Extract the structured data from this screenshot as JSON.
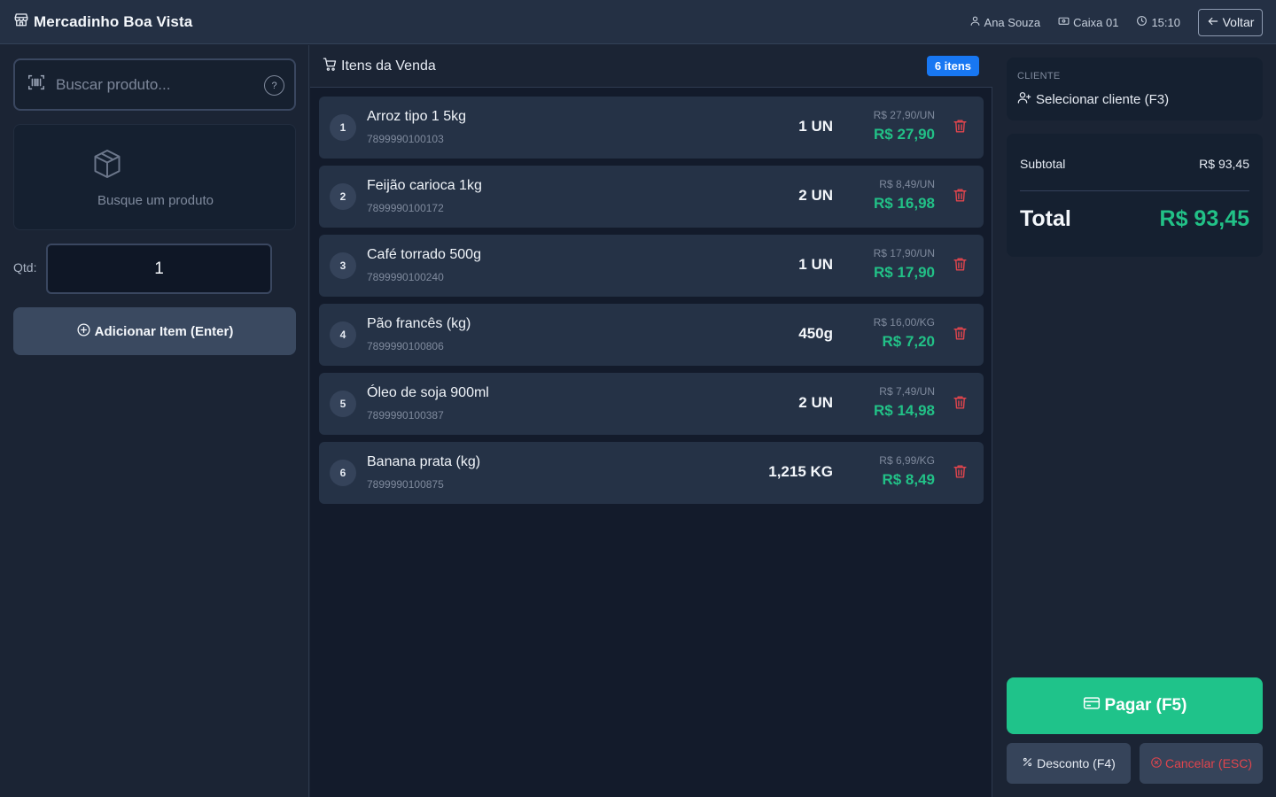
{
  "header": {
    "store_name": "Mercadinho Boa Vista",
    "store_icon": "store-icon",
    "user": "Ana Souza",
    "register": "Caixa 01",
    "time": "15:10",
    "back_label": "Voltar"
  },
  "left": {
    "search_placeholder": "Buscar produto...",
    "help_symbol": "?",
    "preview_hint": "Busque um produto",
    "qty_label": "Qtd:",
    "qty_value": "1",
    "add_button_label": "Adicionar Item (Enter)"
  },
  "sale": {
    "title": "Itens da Venda",
    "count_badge": "6 itens",
    "items": [
      {
        "index": "1",
        "name": "Arroz tipo 1 5kg",
        "code": "7899990100103",
        "qty": "1 UN",
        "unit_price": "R$ 27,90/UN",
        "total": "R$ 27,90"
      },
      {
        "index": "2",
        "name": "Feijão carioca 1kg",
        "code": "7899990100172",
        "qty": "2 UN",
        "unit_price": "R$ 8,49/UN",
        "total": "R$ 16,98"
      },
      {
        "index": "3",
        "name": "Café torrado 500g",
        "code": "7899990100240",
        "qty": "1 UN",
        "unit_price": "R$ 17,90/UN",
        "total": "R$ 17,90"
      },
      {
        "index": "4",
        "name": "Pão francês (kg)",
        "code": "7899990100806",
        "qty": "450g",
        "unit_price": "R$ 16,00/KG",
        "total": "R$ 7,20"
      },
      {
        "index": "5",
        "name": "Óleo de soja 900ml",
        "code": "7899990100387",
        "qty": "2 UN",
        "unit_price": "R$ 7,49/UN",
        "total": "R$ 14,98"
      },
      {
        "index": "6",
        "name": "Banana prata (kg)",
        "code": "7899990100875",
        "qty": "1,215 KG",
        "unit_price": "R$ 6,99/KG",
        "total": "R$ 8,49"
      }
    ]
  },
  "right": {
    "client_label": "CLIENTE",
    "client_select": "Selecionar cliente (F3)",
    "subtotal_label": "Subtotal",
    "subtotal_value": "R$ 93,45",
    "total_label": "Total",
    "total_value": "R$ 93,45",
    "pay_label": "Pagar (F5)",
    "discount_label": "Desconto (F4)",
    "cancel_label": "Cancelar (ESC)"
  },
  "colors": {
    "accent_green": "#1fc38a",
    "badge_blue": "#1877f2",
    "danger_red": "#e0454d"
  }
}
